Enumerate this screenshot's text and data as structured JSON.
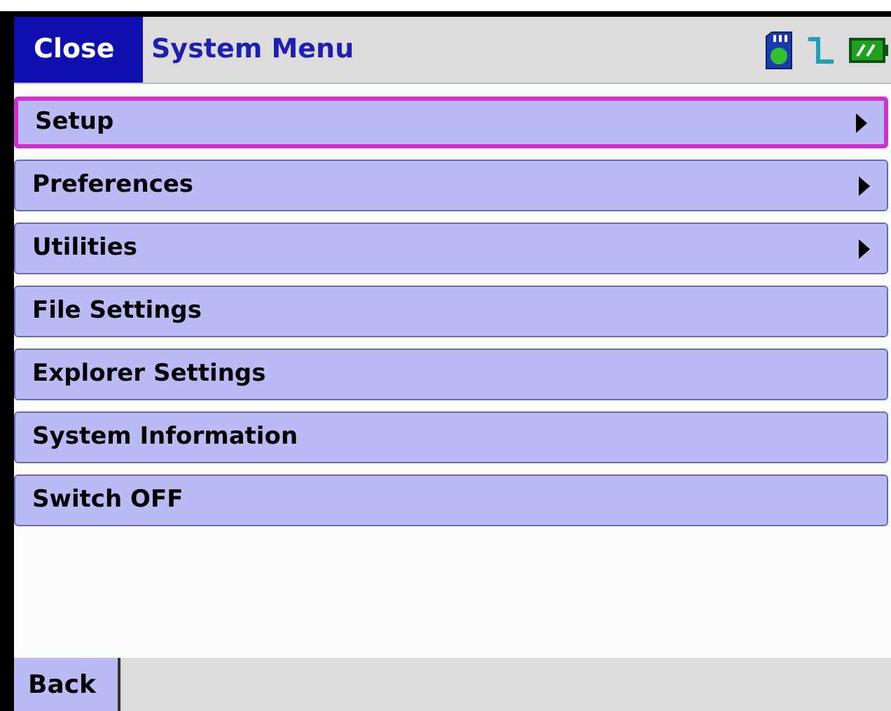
{
  "header": {
    "close_button": "Close",
    "title": "System Menu"
  },
  "menu": [
    {
      "label": "Setup",
      "submenu": true,
      "selected": true
    },
    {
      "label": "Preferences",
      "submenu": true,
      "selected": false
    },
    {
      "label": "Utilities",
      "submenu": true,
      "selected": false
    },
    {
      "label": "File Settings",
      "submenu": false,
      "selected": false
    },
    {
      "label": "Explorer Settings",
      "submenu": false,
      "selected": false
    },
    {
      "label": "System Information",
      "submenu": false,
      "selected": false
    },
    {
      "label": "Switch OFF",
      "submenu": false,
      "selected": false
    }
  ],
  "footer": {
    "back_button": "Back"
  }
}
